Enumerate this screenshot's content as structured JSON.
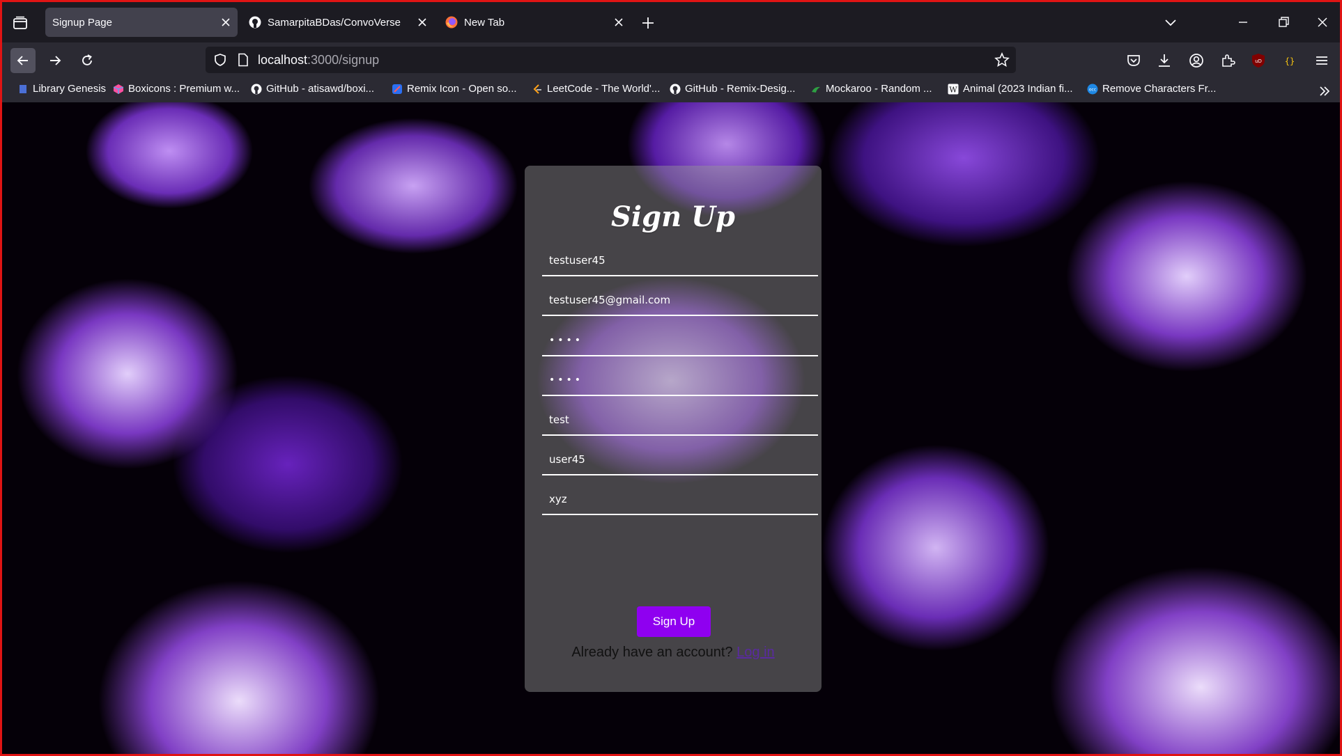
{
  "browser": {
    "tabs": [
      {
        "title": "Signup Page",
        "active": true
      },
      {
        "title": "SamarpitaBDas/ConvoVerse",
        "active": false
      },
      {
        "title": "New Tab",
        "active": false
      }
    ],
    "url_host": "localhost",
    "url_path": ":3000/signup",
    "bookmarks": [
      "Library Genesis",
      "Boxicons : Premium w...",
      "GitHub - atisawd/boxi...",
      "Remix Icon - Open so...",
      "LeetCode - The World'...",
      "GitHub - Remix-Desig...",
      "Mockaroo - Random ...",
      "Animal (2023 Indian fi...",
      "Remove Characters Fr..."
    ]
  },
  "form": {
    "title": "Sign Up",
    "username": "testuser45",
    "email": "testuser45@gmail.com",
    "password": "••••",
    "confirm_password": "••••",
    "first_name": "test",
    "last_name": "user45",
    "extra": "xyz",
    "submit_label": "Sign Up",
    "login_prompt": "Already have an account?",
    "login_link": "Log in"
  },
  "colors": {
    "accent": "#8f00f0",
    "frame_border": "#e01414",
    "link": "#5a2aa0"
  }
}
